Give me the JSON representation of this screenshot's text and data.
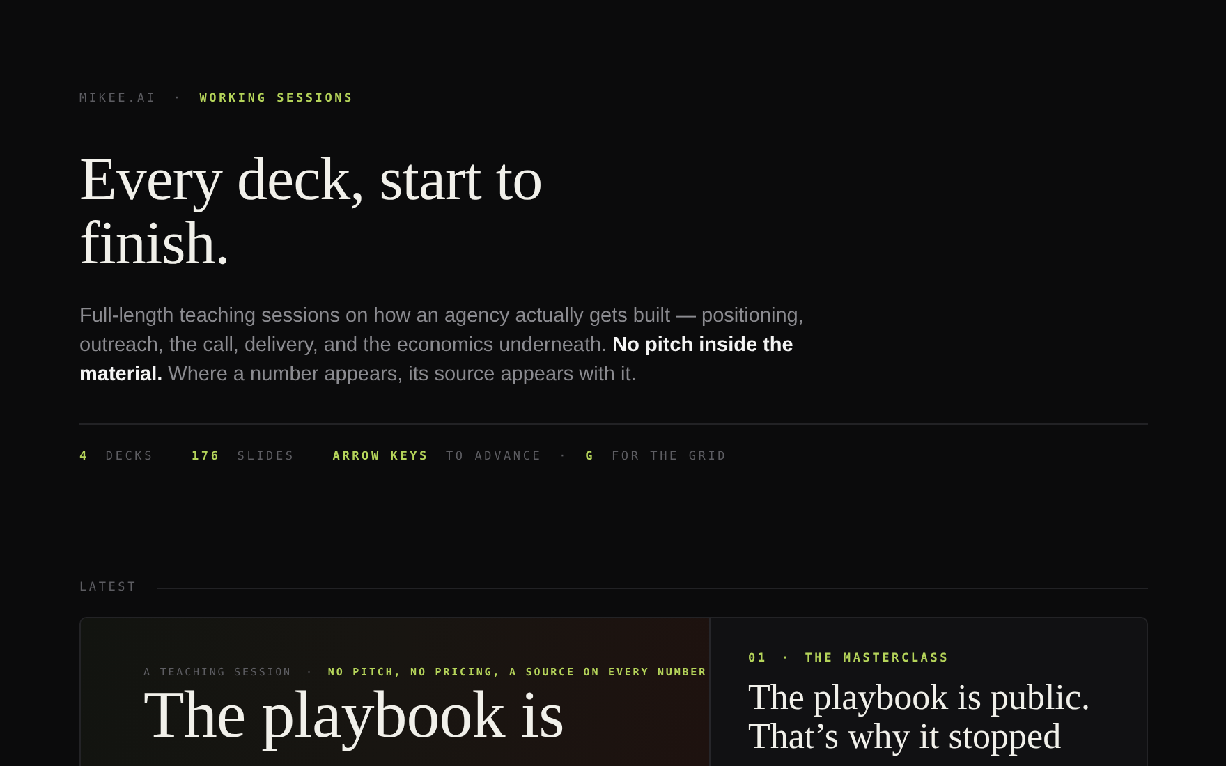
{
  "eyebrow": {
    "brand": "MIKEE.AI",
    "separator": "·",
    "section": "WORKING SESSIONS"
  },
  "headline": "Every deck, start to finish.",
  "intro": "Full-length teaching sessions on how an agency actually gets built — positioning, outreach, the call, delivery, and the economics underneath. **No pitch inside the material.** Where a number appears, its source appears with it.",
  "stats": [
    {
      "value": "4",
      "label": "DECKS"
    },
    {
      "value": "176",
      "label": "SLIDES"
    }
  ],
  "hints": [
    {
      "key": "ARROW KEYS",
      "label": "TO ADVANCE"
    },
    {
      "key": "G",
      "label": "FOR THE GRID"
    }
  ],
  "hint_separator": "·",
  "latest": {
    "label": "LATEST",
    "feature": {
      "kicker": "A TEACHING SESSION",
      "separator": "·",
      "tagline": "NO PITCH, NO PRICING, A SOURCE ON EVERY NUMBER",
      "title": "The playbook is"
    },
    "side": {
      "number": "01",
      "separator": "·",
      "series": "THE MASTERCLASS",
      "title": "The playbook is public. That’s why it stopped"
    }
  }
}
